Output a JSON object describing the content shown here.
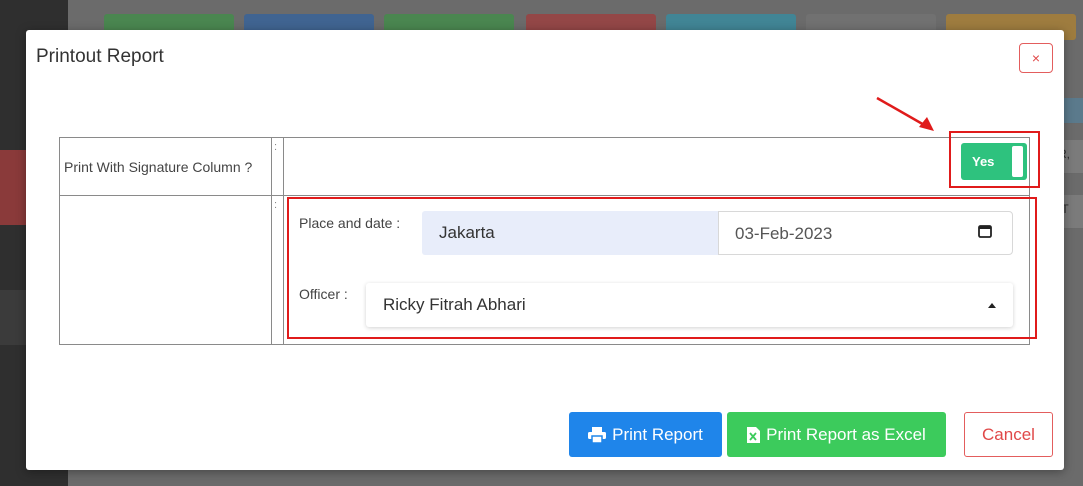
{
  "modal": {
    "title": "Printout Report",
    "close_label": "×"
  },
  "form": {
    "signature_label": "Print With Signature Column ?",
    "separator": ":",
    "toggle_label": "Yes",
    "toggle_on": true,
    "place_date_label": "Place and date :",
    "place_value": "Jakarta",
    "date_value": "03-Feb-2023",
    "officer_label": "Officer :",
    "officer_value": "Ricky Fitrah Abhari"
  },
  "buttons": {
    "print": "Print Report",
    "excel": "Print Report as Excel",
    "cancel": "Cancel"
  },
  "background": {
    "right_text_1": "R,",
    "right_text_2": "IT"
  },
  "colors": {
    "primary": "#1f85ea",
    "success": "#3ccb5c",
    "danger": "#e04848",
    "highlight": "#e01b1b"
  }
}
